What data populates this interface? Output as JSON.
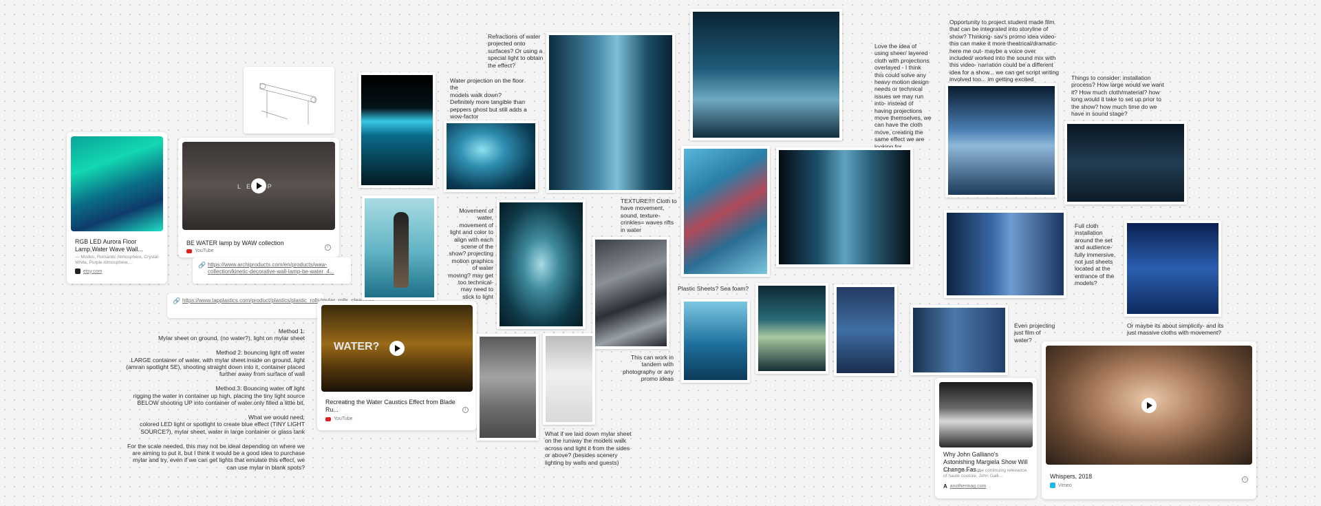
{
  "notes": {
    "refractions": "Refractions of water\nprojected onto\nsurfaces? Or using a\nspecial light to obtain\nthe effect?",
    "projection_floor": "Water projection on the floor the\nmodels walk down?\nDefinitely more tangible than\npeppers ghost but still adds a\nwow-factor",
    "movement": "Movement of\nwater,\nmovement of\nlight and color to\nalign with each\nscene of the\nshow? projecting\nmotion graphics\nof water\nmoving? may get\ntoo technical-\nmay need to\nstick to light",
    "texture": "TEXTURE!!!! Cloth to\nhave movement,\nsound, texture-\ncrinkles= waves rifts\nin water",
    "tandem": "This can work in\ntandem with\nphotography or any\npromo ideas",
    "mylar_runway": "What if we laid down mylar sheet\non the runway the models walk\nacross and light it from the sides\nor above? (besides scenery\nlighting by walls and guests)",
    "plastic": "Plastic Sheets? Sea foam?",
    "sheer_cloth": "Love the idea of\nusing sheer/ layered\ncloth with projections\noverlayed - I think\nthis could solve any\nheavy motion design\nneeds or technical\nissues we may run\ninto- instead of\nhaving projections\nmove themselves, we\ncan have the cloth\nmove, creating the\nsame effect we are\nlooking for.",
    "student_film": "Opportunity to project student made film\nthat can be integrated into storyline of\nshow? Thinking- sav's promo idea video-\nthis can make it more theatrical/dramatic-\nhere me out- maybe a voice over\nincluded/ worked into the sound mix with\nthis video- narration could be a different\nidea for a show... we can get script writing\ninvolved too... im getting excited",
    "consider": "Things to consider: installation\nprocess? How large would we want\nit? How much cloth/material? how\nlong would it take to set up prior to\nthe show? how much time do we\nhave in sound stage?",
    "full_cloth": "Full cloth\ninstallation\naround the set\nand audience-\nfully immersive,\nnot just sheets\nlocated at the\nentrance of the\nmodels?",
    "projecting_film": "Even projecting\njust film of\nwater?",
    "simplicity": "Or maybe its about simplicity- and its\njust massive cloths with movement?",
    "methods": "Method 1:\nMylar sheet on ground, (no water?), light on mylar sheet\n\nMethod 2: bouncing light off water\nLARGE container of water, with mylar sheet inside on ground, light\n(amran spotlight SE), shooting straight down into it, container placed\nfurther away from surface of wall\n\nMethod 3: Bouncing water off light\nrigging the water in container up high, placing the tiny light source\nBELOW shooting UP into container of water.only filled a little bit,\n\nWhat we would need:\ncolored LED light or spotlight to create blue effect (TINY LIGHT\nSOURCE?), mylar sheet, water in large container or glass tank\n\nFor the scale needed, this may not be ideal depending on where we\nare aiming to put it, but I think it would be a good idea to purchase\nmylar and try, even if we can get lights that emulate this effect, we\ncan use mylar in blank spots?"
  },
  "cards": {
    "etsy": {
      "title": "RGB LED Aurora Floor Lamp,Water Wave Wall...",
      "subtitle": "— Modes, Romantic Atmosphere, Crystal White, Purple Atmosphere,...",
      "source": "etsy.com"
    },
    "bewater": {
      "title": "BE WATER lamp by WAW collection",
      "source": "YouTube",
      "overlay": "L E   M P"
    },
    "caustics": {
      "title": "Recreating the Water Caustics Effect from Blade Ru...",
      "source": "YouTube",
      "overlay": "WATER?"
    },
    "galliano": {
      "title": "Why John Galliano's Astonishing Margiela Show Will Change Fas...",
      "subtitle": "A justification for the continuing relevance of haute couture, John Galli...",
      "source": "anothermag.com"
    },
    "whispers": {
      "title": "Whispers, 2018",
      "source": "Vimeo"
    }
  },
  "links": {
    "archi": "https://www.archiproducts.com/en/products/waw-collection/kinetic-decorative-wall-lamp-be-water_4...",
    "tap": "https://www.tapplastics.com/product/plastics/plastic_rolls/mylar_rolls_clear/255"
  },
  "colors": {
    "accent_water": "#1b6a8f",
    "youtube": "#e02020",
    "vimeo": "#1ab7ea"
  }
}
